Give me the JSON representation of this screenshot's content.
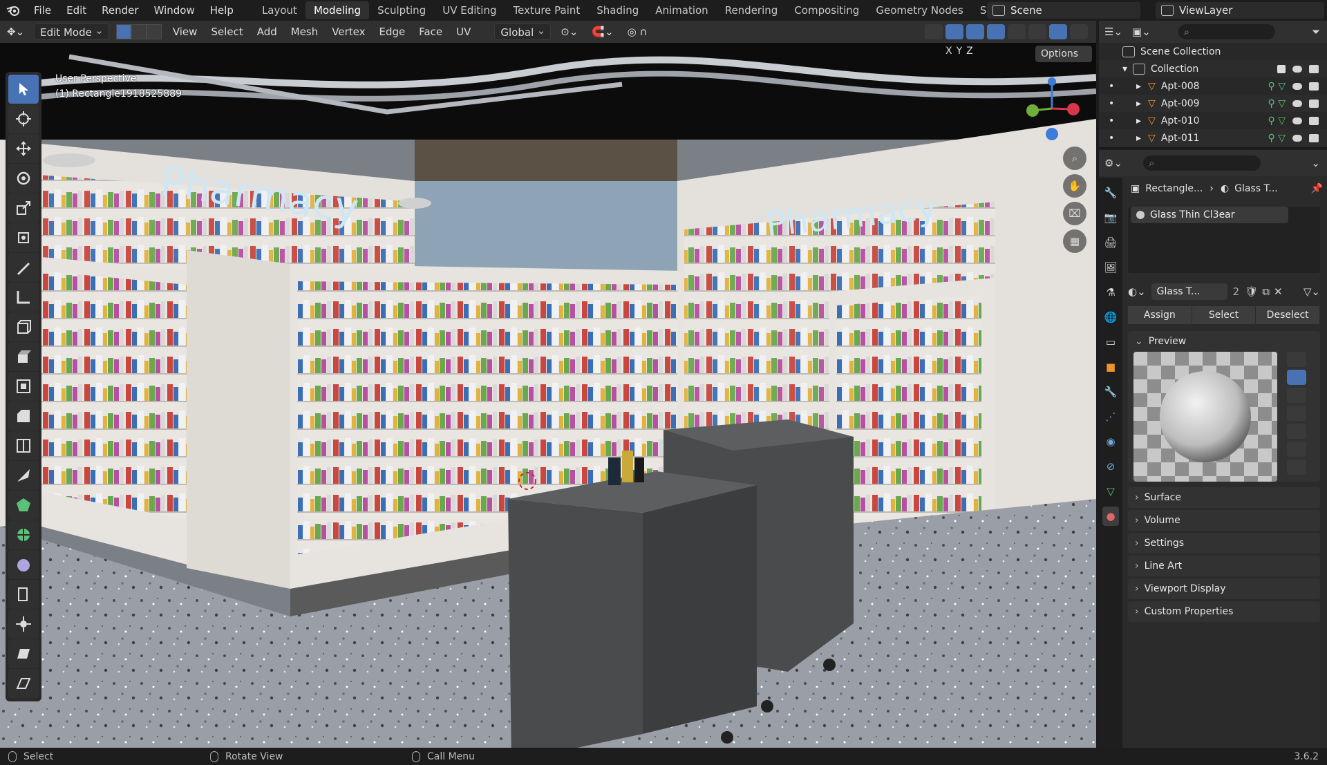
{
  "menu": {
    "items": [
      "File",
      "Edit",
      "Render",
      "Window",
      "Help"
    ]
  },
  "workspaces": {
    "tabs": [
      "Layout",
      "Modeling",
      "Sculpting",
      "UV Editing",
      "Texture Paint",
      "Shading",
      "Animation",
      "Rendering",
      "Compositing",
      "Geometry Nodes",
      "Scripting"
    ],
    "active": "Modeling"
  },
  "scene": {
    "name": "Scene"
  },
  "view_layer": {
    "name": "ViewLayer"
  },
  "viewport_header": {
    "mode": "Edit Mode",
    "menus": [
      "View",
      "Select",
      "Add",
      "Mesh",
      "Vertex",
      "Edge",
      "Face",
      "UV"
    ],
    "orientation": "Global"
  },
  "viewport": {
    "perspective": "User Perspective",
    "object": "(1) Rectangle1918525889",
    "options_label": "Options",
    "axes": [
      "X",
      "Y",
      "Z"
    ],
    "signs": [
      "Pharmacy",
      "Pharmacy"
    ]
  },
  "outliner": {
    "root": "Scene Collection",
    "collection": "Collection",
    "items": [
      "Apt-008",
      "Apt-009",
      "Apt-010",
      "Apt-011"
    ]
  },
  "properties": {
    "breadcrumb_object": "Rectangle...",
    "breadcrumb_material": "Glass T...",
    "material_slot": "Glass Thin Cl3ear",
    "material_name": "Glass T...",
    "users": "2",
    "buttons": {
      "assign": "Assign",
      "select": "Select",
      "deselect": "Deselect"
    },
    "preview_label": "Preview",
    "panels": [
      "Surface",
      "Volume",
      "Settings",
      "Line Art",
      "Viewport Display",
      "Custom Properties"
    ]
  },
  "status": {
    "select": "Select",
    "rotate": "Rotate View",
    "call_menu": "Call Menu",
    "version": "3.6.2"
  },
  "colors": {
    "accent": "#4772b3",
    "object": "#f0932b",
    "mesh": "#5bc07a"
  }
}
